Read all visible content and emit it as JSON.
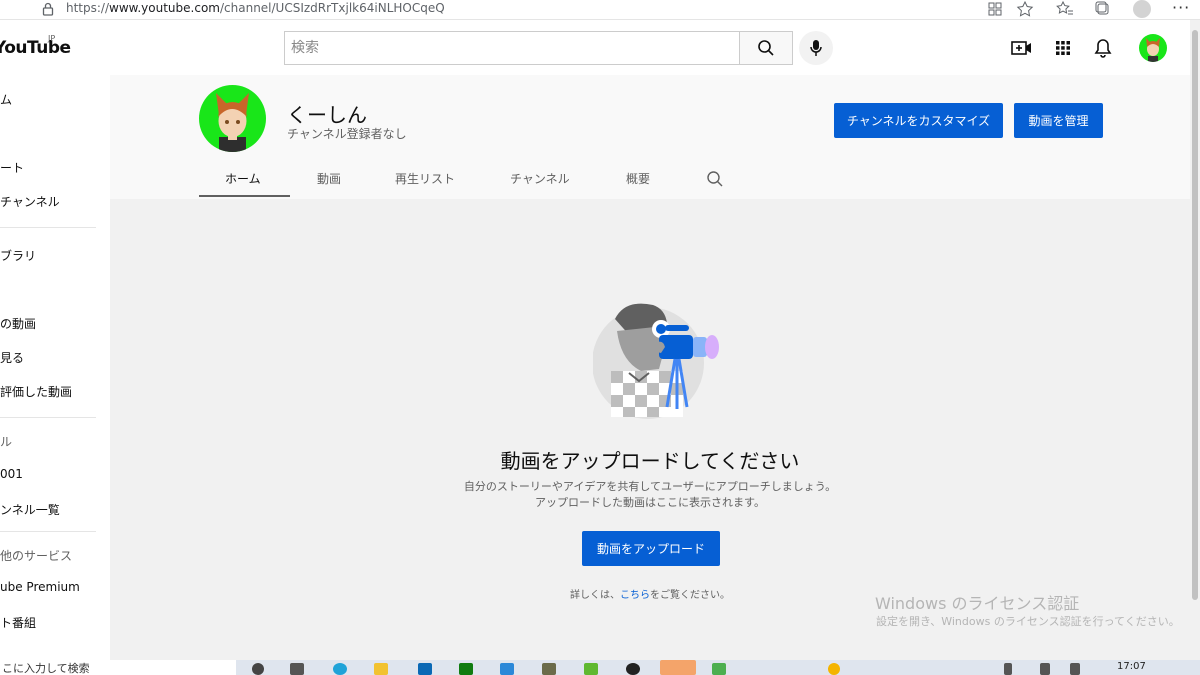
{
  "browser": {
    "url_prefix": "https://",
    "url_host": "www.youtube.com",
    "url_path": "/channel/UCSIzdRrTxjlk64iNLHOCqeQ",
    "more_label": "···"
  },
  "header": {
    "logo_text": "YouTube",
    "logo_region": "JP",
    "search_placeholder": "検索"
  },
  "sidebar": {
    "items": [
      {
        "label": "ム"
      },
      {
        "label": "ート"
      },
      {
        "label": "チャンネル"
      },
      {
        "label": "ブラリ"
      },
      {
        "label": "の動画"
      },
      {
        "label": "見る"
      },
      {
        "label": "評価した動画"
      },
      {
        "label": "ル"
      },
      {
        "label": "001"
      },
      {
        "label": "ンネル一覧"
      },
      {
        "label": "他のサービス"
      },
      {
        "label": "ube Premium"
      },
      {
        "label": "ト番組"
      }
    ]
  },
  "channel": {
    "name": "くーしん",
    "subscribers": "チャンネル登録者なし",
    "customize_label": "チャンネルをカスタマイズ",
    "manage_label": "動画を管理",
    "tabs": [
      {
        "label": "ホーム"
      },
      {
        "label": "動画"
      },
      {
        "label": "再生リスト"
      },
      {
        "label": "チャンネル"
      },
      {
        "label": "概要"
      }
    ]
  },
  "empty_state": {
    "title": "動画をアップロードしてください",
    "desc_line1": "自分のストーリーやアイデアを共有してユーザーにアプローチしましょう。",
    "desc_line2": "アップロードした動画はここに表示されます。",
    "upload_label": "動画をアップロード",
    "learn_prefix": "詳しくは、",
    "learn_link": "こちら",
    "learn_suffix": "をご覧ください。"
  },
  "watermark": {
    "line1": "Windows のライセンス認証",
    "line2": "設定を開き、Windows のライセンス認証を行ってください。"
  },
  "taskbar": {
    "search_text": "こに入力して検索",
    "clock": "17:07"
  },
  "colors": {
    "accent": "#065fd4",
    "avatar_bg": "#19e619"
  }
}
